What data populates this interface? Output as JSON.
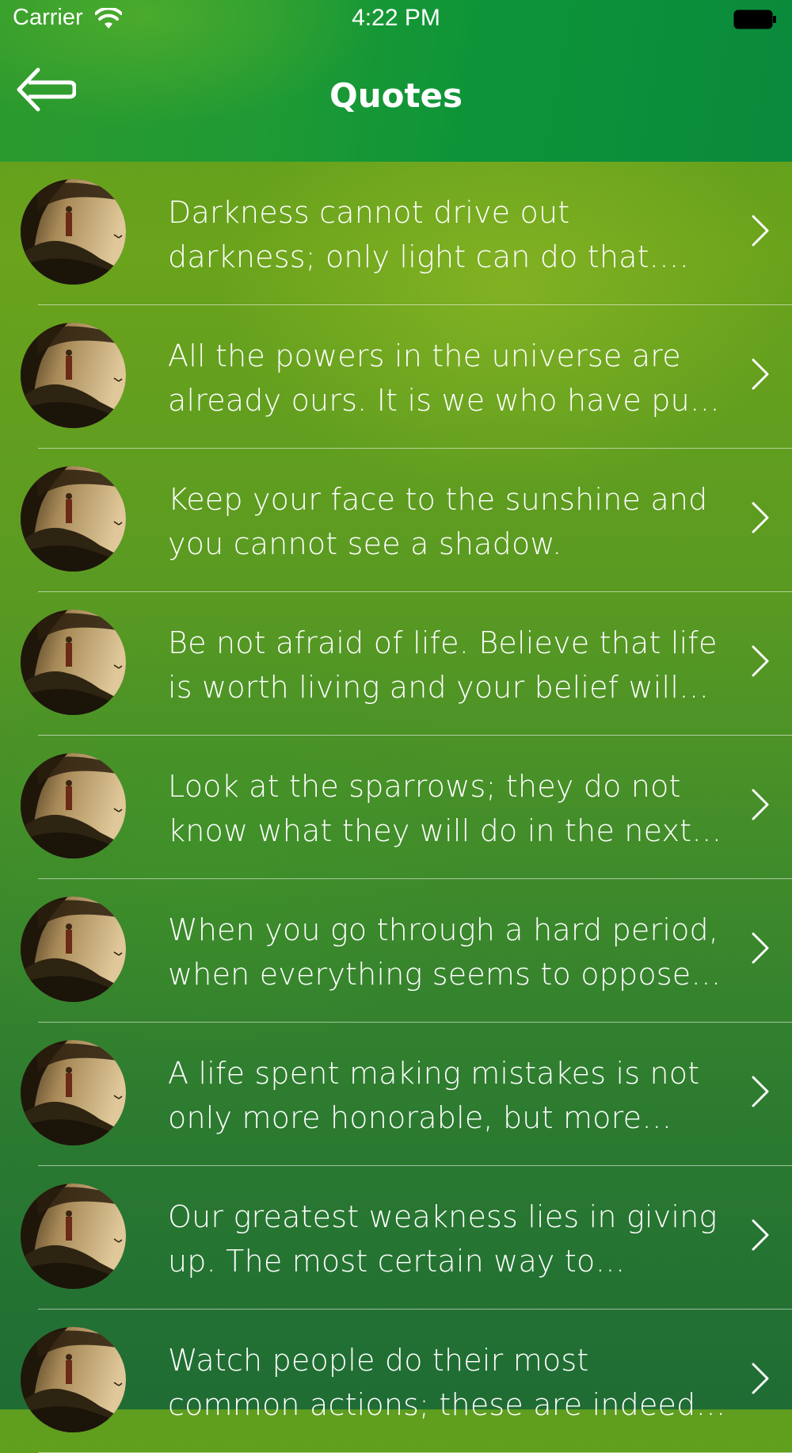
{
  "status_bar": {
    "carrier": "Carrier",
    "time": "4:22 PM"
  },
  "nav": {
    "title": "Quotes",
    "back_icon": "back-arrow-icon"
  },
  "quotes": [
    {
      "text": "Darkness cannot drive out darkness; only light can do that. Hate cannot drive out hate; only love can do that."
    },
    {
      "text": "All the powers in the universe are already ours. It is we who have put our hands before our eyes and cry that it is dark."
    },
    {
      "text": "Keep your face to the sunshine and you cannot see a shadow."
    },
    {
      "text": "Be not afraid of life. Believe that life is worth living and your belief will help create the fact."
    },
    {
      "text": "Look at the sparrows; they do not know what they will do in the next moment."
    },
    {
      "text": "When you go through a hard period, when everything seems to oppose you, when you feel you cannot even bear one more minute, never give up."
    },
    {
      "text": "A life spent making mistakes is not only more honorable, but more useful than a life spent doing nothing."
    },
    {
      "text": "Our greatest weakness lies in giving up. The most certain way to succeed is always to try just one more time."
    },
    {
      "text": "Watch people do their most common actions; these are indeed the things that will show you what a great man really is."
    }
  ],
  "colors": {
    "accent": "#0d9438",
    "text": "#ffffff"
  }
}
